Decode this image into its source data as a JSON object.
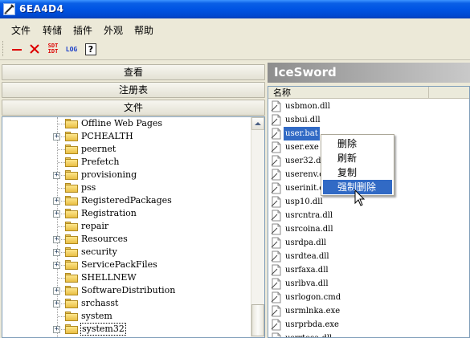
{
  "window": {
    "title": "6EA4D4"
  },
  "menu": [
    "文件",
    "转储",
    "插件",
    "外观",
    "帮助"
  ],
  "toolbar": {
    "buttons": [
      {
        "name": "minimize-icon",
        "text": ""
      },
      {
        "name": "close-icon",
        "text": ""
      },
      {
        "name": "sdt-idt-icon",
        "line1": "SDT",
        "line2": "IDT"
      },
      {
        "name": "log-icon",
        "text": "LOG"
      },
      {
        "name": "help-icon",
        "text": "?"
      }
    ]
  },
  "left": {
    "nav": {
      "view": "查看",
      "registry": "注册表",
      "files": "文件"
    },
    "tree": [
      {
        "label": "Offline Web Pages",
        "expander": ""
      },
      {
        "label": "PCHEALTH",
        "expander": "+"
      },
      {
        "label": "peernet",
        "expander": ""
      },
      {
        "label": "Prefetch",
        "expander": ""
      },
      {
        "label": "provisioning",
        "expander": "+"
      },
      {
        "label": "pss",
        "expander": ""
      },
      {
        "label": "RegisteredPackages",
        "expander": "+"
      },
      {
        "label": "Registration",
        "expander": "+"
      },
      {
        "label": "repair",
        "expander": ""
      },
      {
        "label": "Resources",
        "expander": "+"
      },
      {
        "label": "security",
        "expander": "+"
      },
      {
        "label": "ServicePackFiles",
        "expander": "+"
      },
      {
        "label": "SHELLNEW",
        "expander": ""
      },
      {
        "label": "SoftwareDistribution",
        "expander": "+"
      },
      {
        "label": "srchasst",
        "expander": "+"
      },
      {
        "label": "system",
        "expander": ""
      },
      {
        "label": "system32",
        "expander": "+",
        "selected": true
      }
    ]
  },
  "right": {
    "brand": "IceSword",
    "column_name": "名称",
    "files": [
      {
        "name": "usbmon.dll"
      },
      {
        "name": "usbui.dll"
      },
      {
        "name": "user.bat",
        "selected": true
      },
      {
        "name": "user.exe"
      },
      {
        "name": "user32.dll"
      },
      {
        "name": "userenv.dll"
      },
      {
        "name": "userinit.exe"
      },
      {
        "name": "usp10.dll"
      },
      {
        "name": "usrcntra.dll"
      },
      {
        "name": "usrcoina.dll"
      },
      {
        "name": "usrdpa.dll"
      },
      {
        "name": "usrdtea.dll"
      },
      {
        "name": "usrfaxa.dll"
      },
      {
        "name": "usrlbva.dll"
      },
      {
        "name": "usrlogon.cmd"
      },
      {
        "name": "usrmlnka.exe"
      },
      {
        "name": "usrprbda.exe"
      },
      {
        "name": "usrrtosa.dll"
      }
    ]
  },
  "context_menu": {
    "items": [
      {
        "label": "删除"
      },
      {
        "label": "刷新"
      },
      {
        "label": "复制"
      },
      {
        "label": "强制删除",
        "hover": true
      }
    ]
  },
  "colors": {
    "titlebar": "#0054e3",
    "selection": "#316ac5",
    "folder": "#f5d46a",
    "toolbar_red": "#dd0000"
  }
}
